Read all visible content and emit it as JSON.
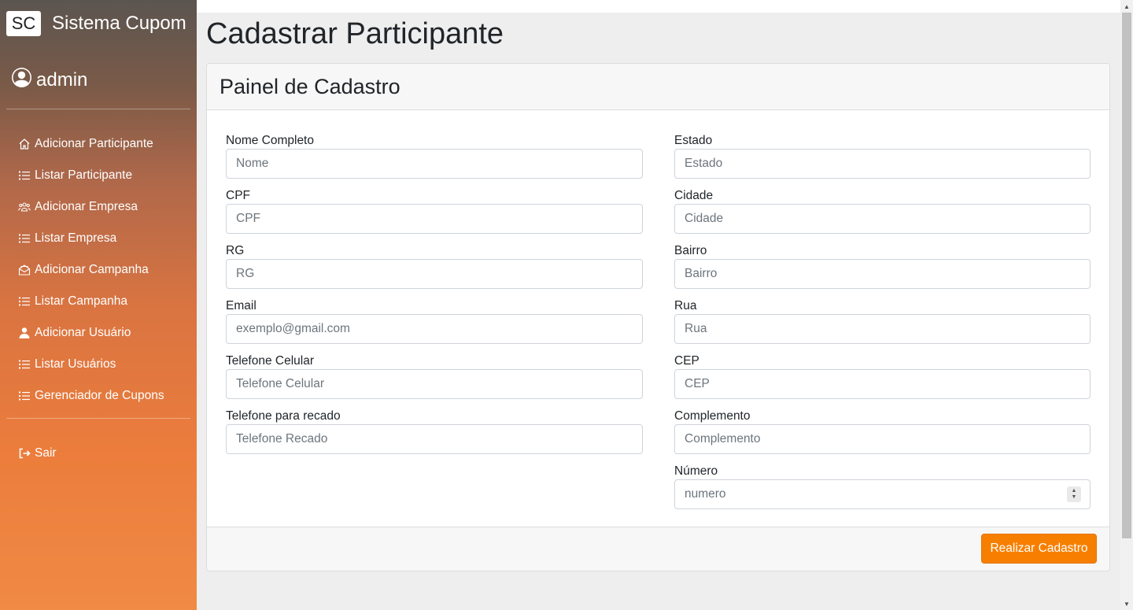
{
  "sidebar": {
    "logo": "SC",
    "app_name": "Sistema Cupom",
    "user_name": "admin",
    "items": [
      {
        "label": "Adicionar Participante",
        "icon": "house-icon"
      },
      {
        "label": "Listar Participante",
        "icon": "list-icon"
      },
      {
        "label": "Adicionar Empresa",
        "icon": "people-icon"
      },
      {
        "label": "Listar Empresa",
        "icon": "list-icon"
      },
      {
        "label": "Adicionar Campanha",
        "icon": "envelope-open-icon"
      },
      {
        "label": "Listar Campanha",
        "icon": "list-icon"
      },
      {
        "label": "Adicionar Usuário",
        "icon": "person-icon"
      },
      {
        "label": "Listar Usuários",
        "icon": "list-icon"
      },
      {
        "label": "Gerenciador de Cupons",
        "icon": "list-icon"
      }
    ],
    "logout_label": "Sair"
  },
  "page": {
    "title": "Cadastrar Participante",
    "card_title": "Painel de Cadastro",
    "submit_label": "Realizar Cadastro"
  },
  "form": {
    "left": [
      {
        "label": "Nome Completo",
        "placeholder": "Nome"
      },
      {
        "label": "CPF",
        "placeholder": "CPF"
      },
      {
        "label": "RG",
        "placeholder": "RG"
      },
      {
        "label": "Email",
        "placeholder": "exemplo@gmail.com"
      },
      {
        "label": "Telefone Celular",
        "placeholder": "Telefone Celular"
      },
      {
        "label": "Telefone para recado",
        "placeholder": "Telefone Recado"
      }
    ],
    "right": [
      {
        "label": "Estado",
        "placeholder": "Estado"
      },
      {
        "label": "Cidade",
        "placeholder": "Cidade"
      },
      {
        "label": "Bairro",
        "placeholder": "Bairro"
      },
      {
        "label": "Rua",
        "placeholder": "Rua"
      },
      {
        "label": "CEP",
        "placeholder": "CEP"
      },
      {
        "label": "Complemento",
        "placeholder": "Complemento"
      },
      {
        "label": "Número",
        "placeholder": "numero"
      }
    ]
  },
  "colors": {
    "accent": "#f77f00",
    "sidebar_top": "#5b5550",
    "sidebar_bottom": "#f08a45"
  }
}
